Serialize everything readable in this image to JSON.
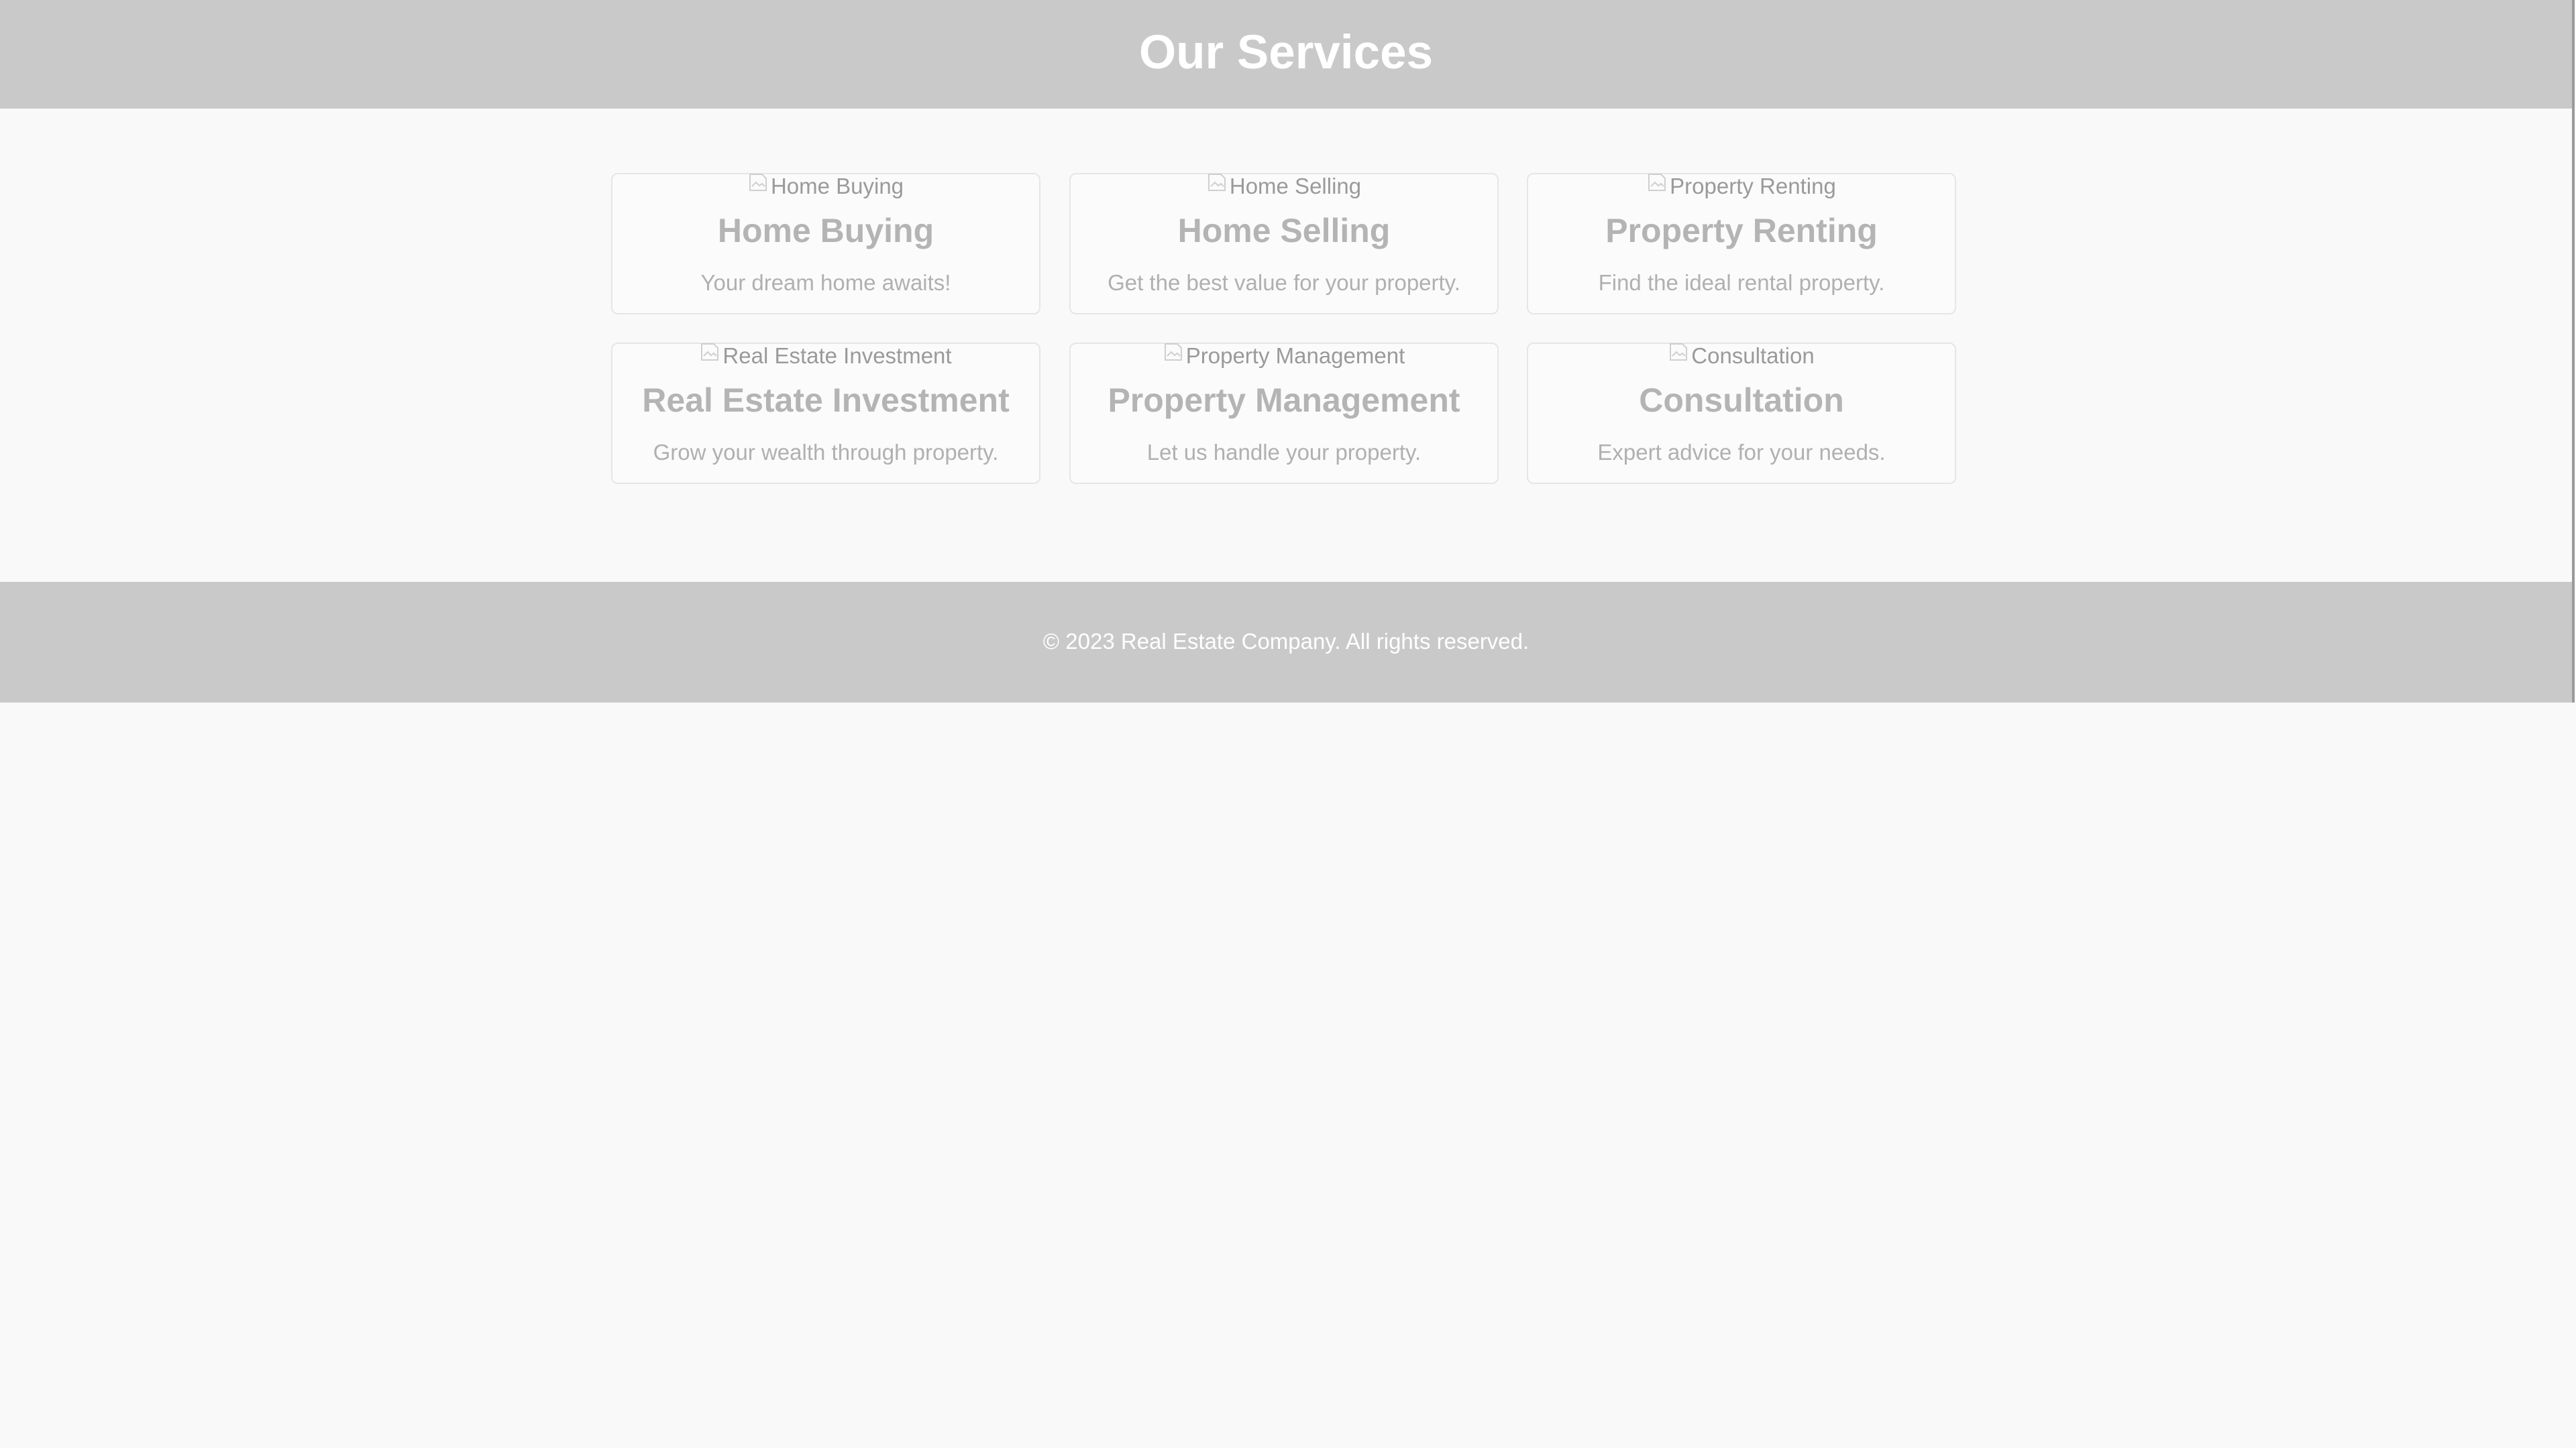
{
  "header": {
    "title": "Our Services"
  },
  "services": [
    {
      "image_alt": "Home Buying",
      "title": "Home Buying",
      "description": "Your dream home awaits!",
      "icon": "broken-image-icon"
    },
    {
      "image_alt": "Home Selling",
      "title": "Home Selling",
      "description": "Get the best value for your property.",
      "icon": "broken-image-icon"
    },
    {
      "image_alt": "Property Renting",
      "title": "Property Renting",
      "description": "Find the ideal rental property.",
      "icon": "broken-image-icon"
    },
    {
      "image_alt": "Real Estate Investment",
      "title": "Real Estate Investment",
      "description": "Grow your wealth through property.",
      "icon": "broken-image-icon"
    },
    {
      "image_alt": "Property Management",
      "title": "Property Management",
      "description": "Let us handle your property.",
      "icon": "broken-image-icon"
    },
    {
      "image_alt": "Consultation",
      "title": "Consultation",
      "description": "Expert advice for your needs.",
      "icon": "broken-image-icon"
    }
  ],
  "footer": {
    "copyright": "© 2023 Real Estate Company. All rights reserved."
  },
  "colors": {
    "header_bg": "#c9c9c9",
    "page_bg": "#f9f9f9",
    "card_border": "#e6e6e6",
    "heading_text": "#b4b4b4",
    "body_text": "#b0b0b0",
    "banner_text": "#ffffff"
  }
}
